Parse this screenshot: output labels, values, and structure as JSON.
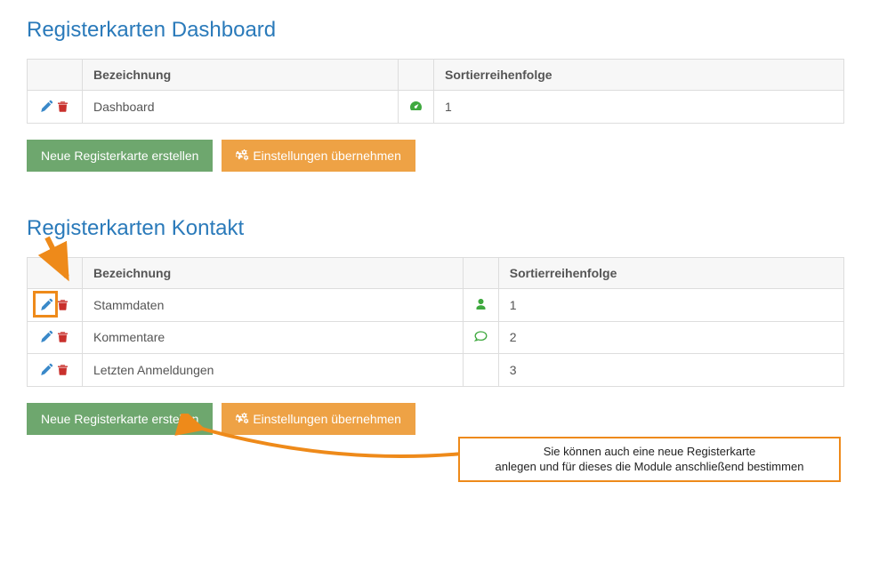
{
  "sections": [
    {
      "title": "Registerkarten Dashboard",
      "headers": {
        "h1": "Bezeichnung",
        "h2": "Sortierreihenfolge"
      },
      "rows": [
        {
          "name": "Dashboard",
          "icon": "dashboard",
          "order": "1"
        }
      ],
      "buttons": {
        "create": "Neue Registerkarte erstellen",
        "apply": "Einstellungen übernehmen"
      }
    },
    {
      "title": "Registerkarten Kontakt",
      "headers": {
        "h1": "Bezeichnung",
        "h2": "Sortierreihenfolge"
      },
      "rows": [
        {
          "name": "Stammdaten",
          "icon": "user",
          "order": "1"
        },
        {
          "name": "Kommentare",
          "icon": "comment",
          "order": "2"
        },
        {
          "name": "Letzten Anmeldungen",
          "icon": "",
          "order": "3"
        }
      ],
      "buttons": {
        "create": "Neue Registerkarte erstellen",
        "apply": "Einstellungen übernehmen"
      }
    }
  ],
  "callout": "Sie können auch eine neue Registerkarte\nanlegen und für dieses die Module anschließend bestimmen"
}
